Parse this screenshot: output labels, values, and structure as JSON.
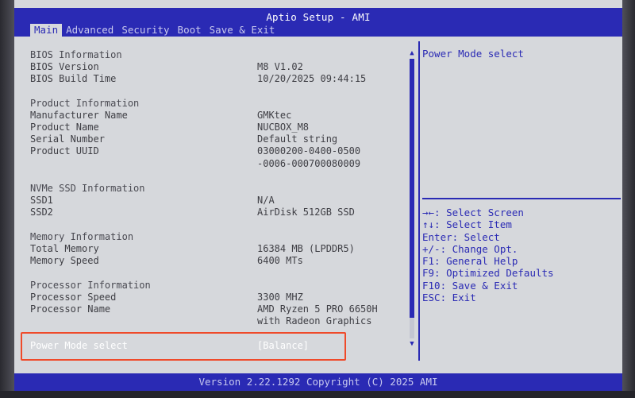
{
  "header": {
    "title": "Aptio Setup - AMI",
    "tabs": [
      "Main",
      "Advanced",
      "Security",
      "Boot",
      "Save & Exit"
    ]
  },
  "main": {
    "bios": {
      "label": "BIOS Information",
      "version_label": "BIOS Version",
      "version_value": "M8 V1.02",
      "build_label": "BIOS Build Time",
      "build_value": "10/20/2025 09:44:15"
    },
    "product": {
      "label": "Product Information",
      "manufacturer_label": "Manufacturer Name",
      "manufacturer_value": "GMKtec",
      "name_label": "Product Name",
      "name_value": "NUCBOX_M8",
      "serial_label": "Serial Number",
      "serial_value": "Default string",
      "uuid_label": "Product UUID",
      "uuid_value_1": "03000200-0400-0500",
      "uuid_value_2": "-0006-000700080009"
    },
    "nvme": {
      "label": "NVMe SSD Information",
      "ssd1_label": "SSD1",
      "ssd1_value": "N/A",
      "ssd2_label": "SSD2",
      "ssd2_value": "AirDisk 512GB SSD"
    },
    "memory": {
      "label": "Memory Information",
      "total_label": "Total Memory",
      "total_value": "16384 MB (LPDDR5)",
      "speed_label": "Memory Speed",
      "speed_value": "6400 MTs"
    },
    "processor": {
      "label": "Processor Information",
      "speed_label": "Processor Speed",
      "speed_value": "3300 MHZ",
      "name_label": "Processor Name",
      "name_value_1": "AMD Ryzen 5 PRO 6650H",
      "name_value_2": "with Radeon Graphics"
    },
    "power_mode": {
      "label": "Power Mode select",
      "value": "[Balance]"
    }
  },
  "help": {
    "text": "Power Mode select",
    "keys": [
      "→←: Select Screen",
      "↑↓: Select Item",
      "Enter: Select",
      "+/-: Change Opt.",
      "F1: General Help",
      "F9: Optimized Defaults",
      "F10: Save & Exit",
      "ESC: Exit"
    ]
  },
  "footer": {
    "text": "Version 2.22.1292 Copyright (C) 2025 AMI"
  },
  "colors": {
    "accent": "#2a2ab4",
    "background": "#d6d8dc",
    "highlight": "#ef4a2a"
  }
}
